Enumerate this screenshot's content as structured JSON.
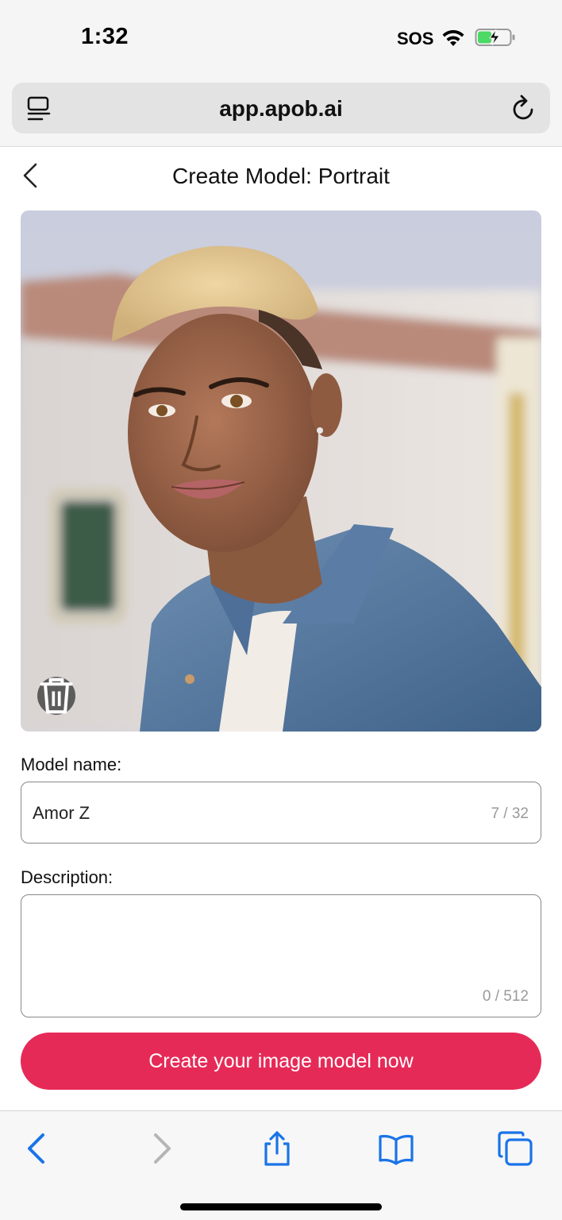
{
  "status_bar": {
    "time": "1:32",
    "carrier": "SOS",
    "icons": [
      "wifi-icon",
      "battery-charging-icon"
    ],
    "battery_color": "#4cd964"
  },
  "browser": {
    "url": "app.apob.ai",
    "icons": [
      "reader-icon",
      "reload-icon"
    ]
  },
  "header": {
    "title": "Create Model: Portrait"
  },
  "photo": {
    "alt": "portrait-photo",
    "delete_icon": "trash-icon"
  },
  "form": {
    "name_label": "Model name:",
    "name_value": "Amor Z",
    "name_counter": "7 / 32",
    "description_label": "Description:",
    "description_value": "",
    "description_counter": "0 / 512",
    "submit_label": "Create your image model now"
  },
  "toolbar": {
    "icons": [
      "back-icon",
      "forward-icon",
      "share-icon",
      "bookmarks-icon",
      "tabs-icon"
    ],
    "accent": "#1a73e8"
  },
  "colors": {
    "cta": "#e62a57",
    "accent": "#1a73e8"
  }
}
